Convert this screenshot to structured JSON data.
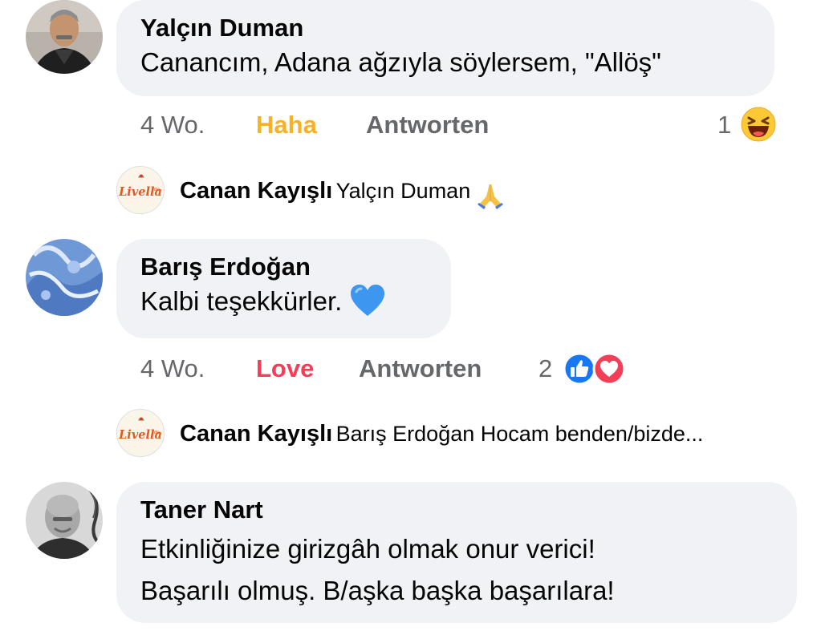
{
  "comments": [
    {
      "author": "Yalçın Duman",
      "text": "Canancım, Adana ağzıyla söylersem, \"Allöş\"",
      "time": "4 Wo.",
      "reaction_label": "Haha",
      "reply_label": "Antworten",
      "reaction_count": "1",
      "reaction_color": "#f7b125",
      "reaction_icons": [
        "haha-emoji-icon"
      ],
      "reply": {
        "author": "Canan Kayışlı",
        "text": "Yalçın Duman",
        "emoji": "folded-hands-emoji-icon",
        "avatar_logo_text": "Livella"
      }
    },
    {
      "author": "Barış Erdoğan",
      "text": "Kalbi teşekkürler.",
      "text_emoji": "blue-heart-emoji-icon",
      "time": "4 Wo.",
      "reaction_label": "Love",
      "reply_label": "Antworten",
      "reaction_count": "2",
      "reaction_color": "#f33e58",
      "reaction_icons": [
        "like-reaction-icon",
        "love-reaction-icon"
      ],
      "reply": {
        "author": "Canan Kayışlı",
        "text": "Barış Erdoğan Hocam benden/bizde...",
        "avatar_logo_text": "Livella"
      }
    },
    {
      "author": "Taner Nart",
      "text_line1": "Etkinliğinize girizgâh olmak onur verici!",
      "text_line2": "Başarılı olmuş. B/aşka başka başarılara!"
    }
  ]
}
